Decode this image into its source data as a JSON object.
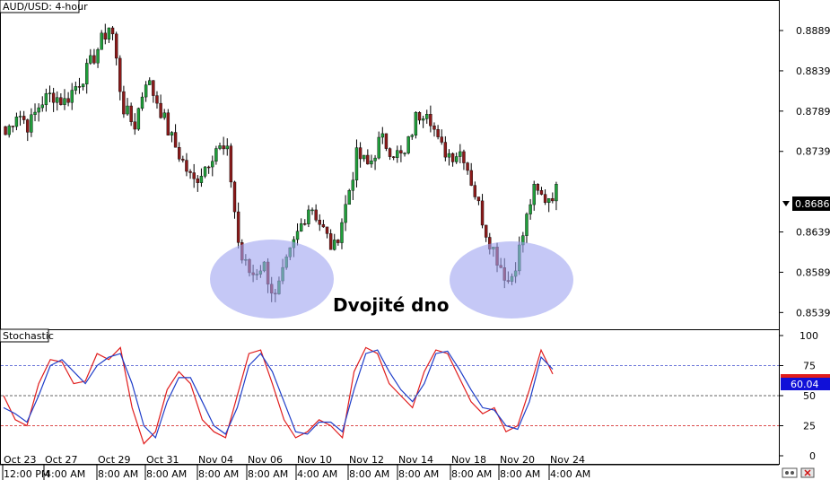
{
  "chart_data": [
    {
      "type": "candlestick",
      "title": "AUD/USD: 4-hour",
      "y_ticks": [
        "0.8889",
        "0.8839",
        "0.8789",
        "0.8739",
        "0.8639",
        "0.8589",
        "0.8539"
      ],
      "ylim": [
        0.8526,
        0.8918
      ],
      "current_price": "0.8686",
      "x_ticks": [
        {
          "day": "Oct 23",
          "time": "12:00 PM"
        },
        {
          "day": "Oct 27",
          "time": "4:00 AM"
        },
        {
          "day": "Oct 29",
          "time": "8:00 AM"
        },
        {
          "day": "Oct 31",
          "time": "8:00 AM"
        },
        {
          "day": "Nov 04",
          "time": "8:00 AM"
        },
        {
          "day": "Nov 06",
          "time": "8:00 AM"
        },
        {
          "day": "Nov 10",
          "time": "4:00 AM"
        },
        {
          "day": "Nov 12",
          "time": "8:00 AM"
        },
        {
          "day": "Nov 14",
          "time": "8:00 AM"
        },
        {
          "day": "Nov 18",
          "time": "8:00 AM"
        },
        {
          "day": "Nov 20",
          "time": "8:00 AM"
        },
        {
          "day": "Nov 24",
          "time": "4:00 AM"
        }
      ],
      "close_path": [
        0.876,
        0.8789,
        0.877,
        0.88,
        0.881,
        0.88,
        0.882,
        0.884,
        0.887,
        0.8899,
        0.8795,
        0.877,
        0.883,
        0.88,
        0.876,
        0.873,
        0.87,
        0.872,
        0.8745,
        0.8735,
        0.861,
        0.8585,
        0.86,
        0.8555,
        0.86,
        0.864,
        0.8675,
        0.8645,
        0.8615,
        0.867,
        0.8735,
        0.872,
        0.8755,
        0.874,
        0.873,
        0.878,
        0.8795,
        0.8745,
        0.8735,
        0.874,
        0.869,
        0.864,
        0.8605,
        0.8575,
        0.8625,
        0.869,
        0.868,
        0.869
      ],
      "annotations": [
        {
          "text": "Dvojité dno"
        }
      ],
      "colors": {
        "bull": "#1f9e3a",
        "bear": "#8b1a1a",
        "ellipse": "#9ea3f0"
      }
    },
    {
      "type": "line",
      "title": "Stochastic",
      "y_ticks": [
        "100",
        "75",
        "50",
        "25",
        "0"
      ],
      "ylim": [
        0,
        100
      ],
      "levels": [
        75,
        50,
        25
      ],
      "current_value": "60.04",
      "series": [
        {
          "color": "#e01c1c",
          "values": [
            50,
            30,
            25,
            60,
            80,
            78,
            60,
            62,
            85,
            80,
            90,
            40,
            10,
            20,
            55,
            70,
            60,
            30,
            20,
            15,
            50,
            85,
            88,
            60,
            30,
            15,
            20,
            30,
            25,
            15,
            70,
            90,
            85,
            60,
            50,
            40,
            70,
            88,
            85,
            65,
            45,
            35,
            40,
            20,
            25,
            55,
            88,
            68
          ]
        },
        {
          "color": "#1f3ec9",
          "values": [
            40,
            35,
            28,
            50,
            75,
            80,
            70,
            60,
            75,
            82,
            85,
            60,
            25,
            15,
            45,
            65,
            65,
            45,
            25,
            18,
            40,
            75,
            85,
            70,
            45,
            20,
            18,
            28,
            28,
            20,
            55,
            85,
            88,
            70,
            55,
            45,
            60,
            85,
            87,
            72,
            55,
            40,
            38,
            25,
            22,
            45,
            82,
            72
          ]
        }
      ],
      "colors": {
        "level_line": "#3a4acb",
        "value_box": "#1010d8"
      }
    }
  ]
}
